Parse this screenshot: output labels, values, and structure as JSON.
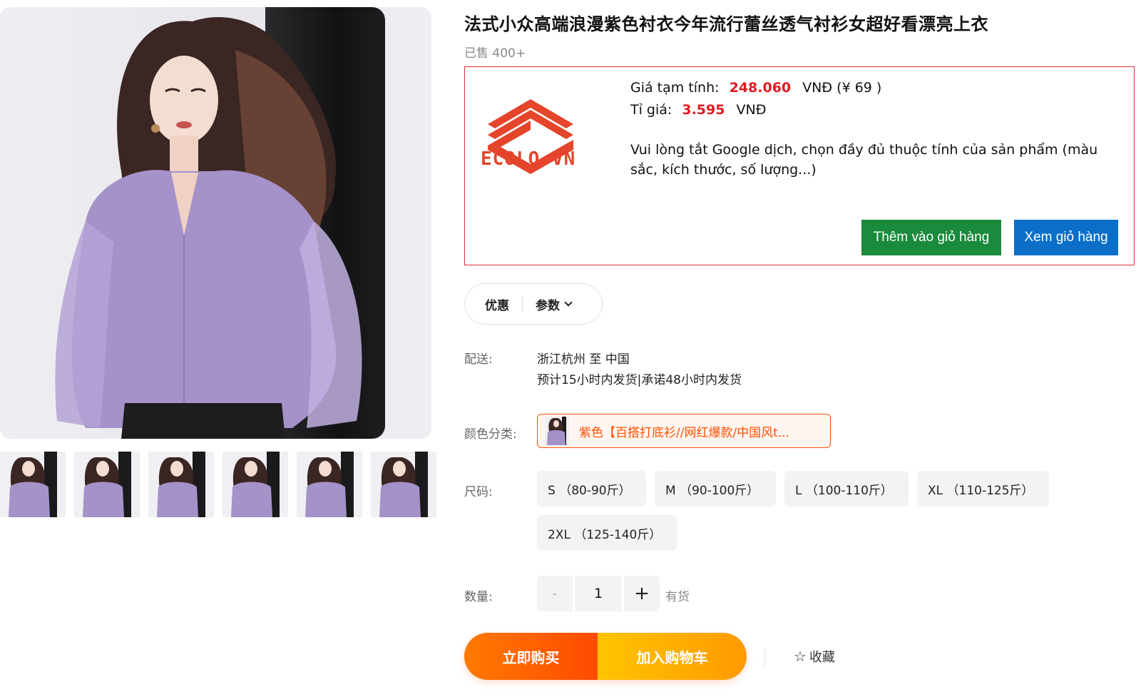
{
  "gallery": {
    "main_alt": "",
    "thumbnails": [
      1,
      2,
      3,
      4,
      5,
      6
    ]
  },
  "product": {
    "title": "法式小众高端浪漫紫色衬衣今年流行蕾丝透气衬衫女超好看漂亮上衣",
    "sold": "已售 400+"
  },
  "ecolo": {
    "logo_text": "ECOLO.VN",
    "price_label": "Giá tạm tính:",
    "price_value": "248.060",
    "price_suffix": "VNĐ (¥ 69 )",
    "rate_label": "Tỉ giá:",
    "rate_value": "3.595",
    "rate_suffix": "VNĐ",
    "note": "Vui lòng tắt Google dịch, chọn đầy đủ thuộc tính của sản phẩm (màu sắc, kích thước, số lượng...)",
    "add_to_cart_label": "Thêm vào giỏ hàng",
    "view_cart_label": "Xem giỏ hàng",
    "colors": {
      "border": "#e0323a",
      "add_btn": "#1a8a3c",
      "view_btn": "#0b6fc9",
      "logo": "#e4452b"
    }
  },
  "tabs": {
    "discount": "优惠",
    "params": "参数"
  },
  "shipping": {
    "label": "配送:",
    "route": "浙江杭州 至 中国",
    "eta": "预计15小时内发货|承诺48小时内发货"
  },
  "color": {
    "label": "颜色分类:",
    "selected": "紫色【百搭打底衫//网红爆款/中国风t..."
  },
  "size": {
    "label": "尺码:",
    "options": [
      "S （80-90斤）",
      "M （90-100斤）",
      "L （100-110斤）",
      "XL （110-125斤）",
      "2XL （125-140斤）"
    ]
  },
  "quantity": {
    "label": "数量:",
    "minus": "-",
    "value": "1",
    "plus": "+",
    "stock": "有货"
  },
  "actions": {
    "buy_now": "立即购买",
    "add_cart": "加入购物车",
    "favorite": "收藏",
    "accent": "#ff5000"
  }
}
